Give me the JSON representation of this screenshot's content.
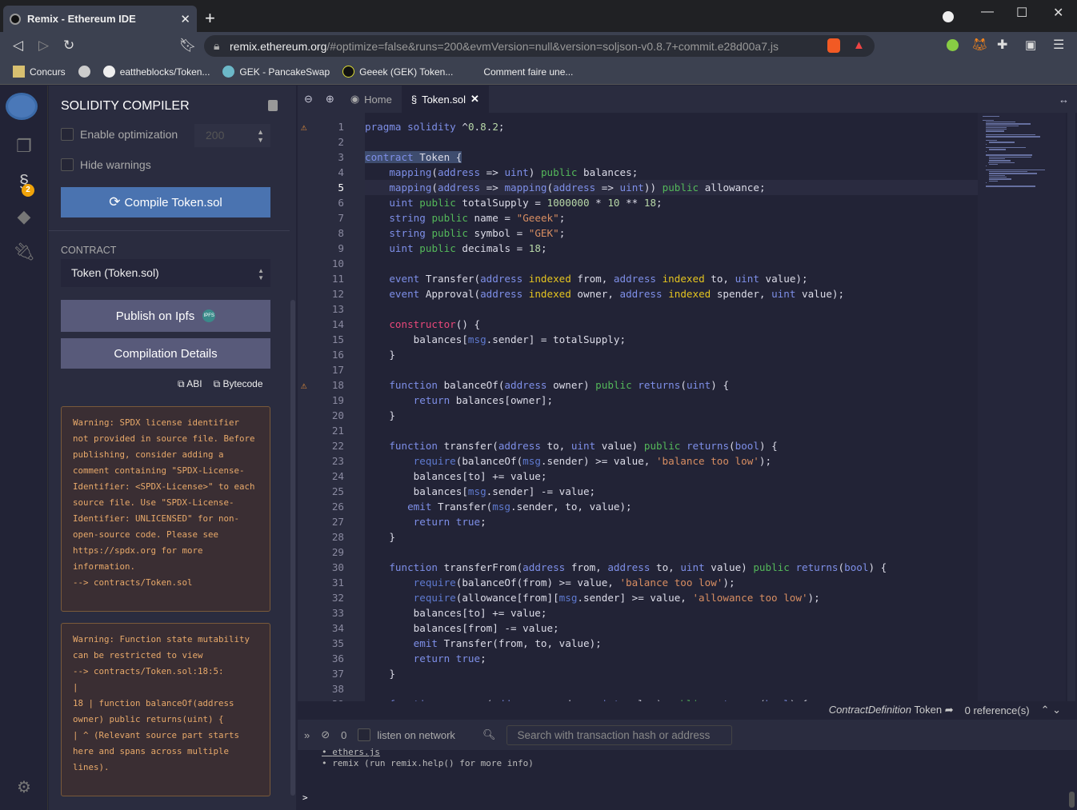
{
  "browser": {
    "tab_title": "Remix - Ethereum IDE",
    "url_host": "remix.ethereum.org",
    "url_rest": "/#optimize=false&runs=200&evmVersion=null&version=soljson-v0.8.7+commit.e28d00a7.js",
    "bookmarks": [
      "Concurs",
      "",
      "eattheblocks/Token...",
      "GEK - PancakeSwap",
      "Geeek (GEK) Token...",
      "Comment faire une..."
    ]
  },
  "icon_panel": {
    "badge": "2"
  },
  "compiler": {
    "title": "SOLIDITY COMPILER",
    "enable_optimization": "Enable optimization",
    "runs": "200",
    "hide_warnings": "Hide warnings",
    "compile_button": "Compile Token.sol",
    "contract_label": "CONTRACT",
    "contract_selected": "Token (Token.sol)",
    "publish_button": "Publish on Ipfs",
    "details_button": "Compilation Details",
    "abi": "ABI",
    "bytecode": "Bytecode",
    "warnings": [
      "Warning: SPDX license identifier not provided in source file. Before publishing, consider adding a comment containing \"SPDX-License-Identifier: <SPDX-License>\" to each source file. Use \"SPDX-License-Identifier: UNLICENSED\" for non-open-source code. Please see https://spdx.org for more information.\n--> contracts/Token.sol",
      "Warning: Function state mutability can be restricted to view\n--> contracts/Token.sol:18:5:\n|\n18 | function balanceOf(address owner) public returns(uint) {\n| ^ (Relevant source part starts here and spans across multiple lines)."
    ]
  },
  "editor": {
    "tabs": [
      "Home",
      "Token.sol"
    ],
    "warning_lines": [
      1,
      18
    ],
    "lines": [
      "pragma solidity ^0.8.2;",
      "",
      "contract Token {",
      "    mapping(address => uint) public balances;",
      "    mapping(address => mapping(address => uint)) public allowance;",
      "    uint public totalSupply = 1000000 * 10 ** 18;",
      "    string public name = \"Geeek\";",
      "    string public symbol = \"GEK\";",
      "    uint public decimals = 18;",
      "",
      "    event Transfer(address indexed from, address indexed to, uint value);",
      "    event Approval(address indexed owner, address indexed spender, uint value);",
      "",
      "    constructor() {",
      "        balances[msg.sender] = totalSupply;",
      "    }",
      "",
      "    function balanceOf(address owner) public returns(uint) {",
      "        return balances[owner];",
      "    }",
      "",
      "    function transfer(address to, uint value) public returns(bool) {",
      "        require(balanceOf(msg.sender) >= value, 'balance too low');",
      "        balances[to] += value;",
      "        balances[msg.sender] -= value;",
      "       emit Transfer(msg.sender, to, value);",
      "        return true;",
      "    }",
      "",
      "    function transferFrom(address from, address to, uint value) public returns(bool) {",
      "        require(balanceOf(from) >= value, 'balance too low');",
      "        require(allowance[from][msg.sender] >= value, 'allowance too low');",
      "        balances[to] += value;",
      "        balances[from] -= value;",
      "        emit Transfer(from, to, value);",
      "        return true;",
      "    }",
      "",
      "    function approve(address spender, uint value) public returns (bool) {"
    ]
  },
  "refbar": {
    "definition": "ContractDefinition",
    "name": "Token",
    "references": "0 reference(s)"
  },
  "terminal": {
    "count": "0",
    "listen": "listen on network",
    "search_placeholder": "Search with transaction hash or address",
    "lines": [
      "ethers.js",
      "remix (run remix.help() for more info)"
    ],
    "prompt": ">"
  }
}
